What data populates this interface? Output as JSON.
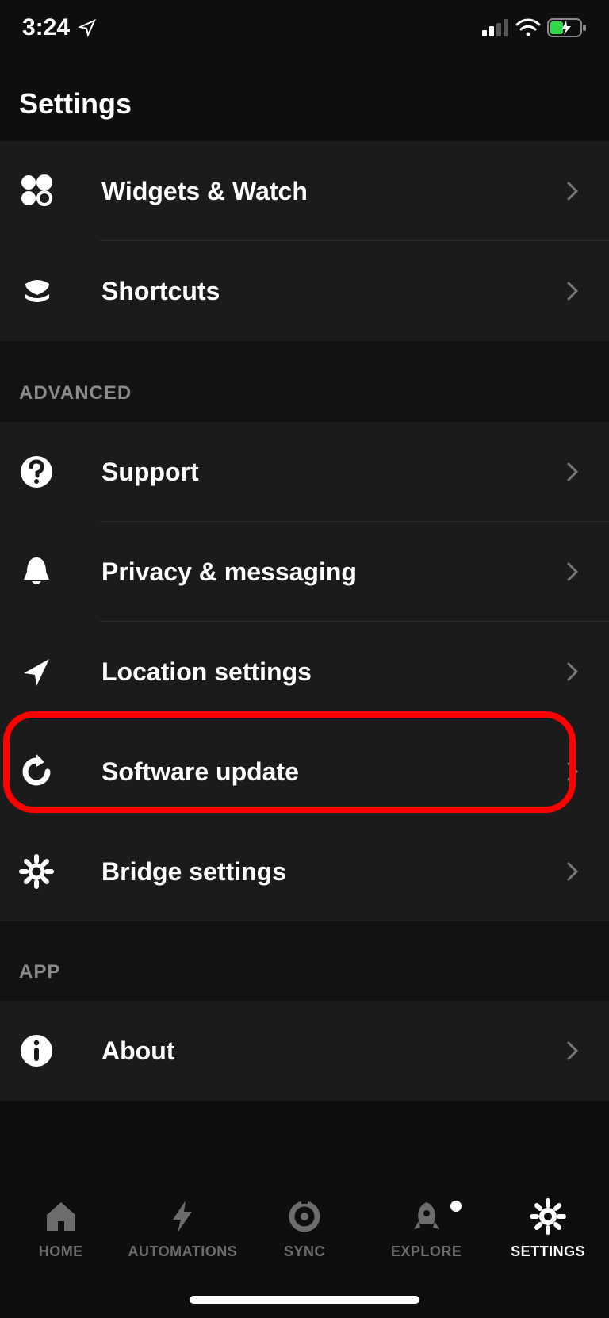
{
  "status": {
    "time": "3:24"
  },
  "header": {
    "title": "Settings"
  },
  "sections": {
    "top": {
      "items": [
        {
          "label": "Widgets & Watch"
        },
        {
          "label": "Shortcuts"
        }
      ]
    },
    "advanced": {
      "title": "ADVANCED",
      "items": [
        {
          "label": "Support"
        },
        {
          "label": "Privacy & messaging"
        },
        {
          "label": "Location settings"
        },
        {
          "label": "Software update"
        },
        {
          "label": "Bridge settings"
        }
      ]
    },
    "app": {
      "title": "APP",
      "items": [
        {
          "label": "About"
        }
      ]
    }
  },
  "tabs": [
    {
      "label": "HOME"
    },
    {
      "label": "AUTOMATIONS"
    },
    {
      "label": "SYNC"
    },
    {
      "label": "EXPLORE"
    },
    {
      "label": "SETTINGS"
    }
  ],
  "annotation": {
    "highlighted_item": "Software update"
  }
}
